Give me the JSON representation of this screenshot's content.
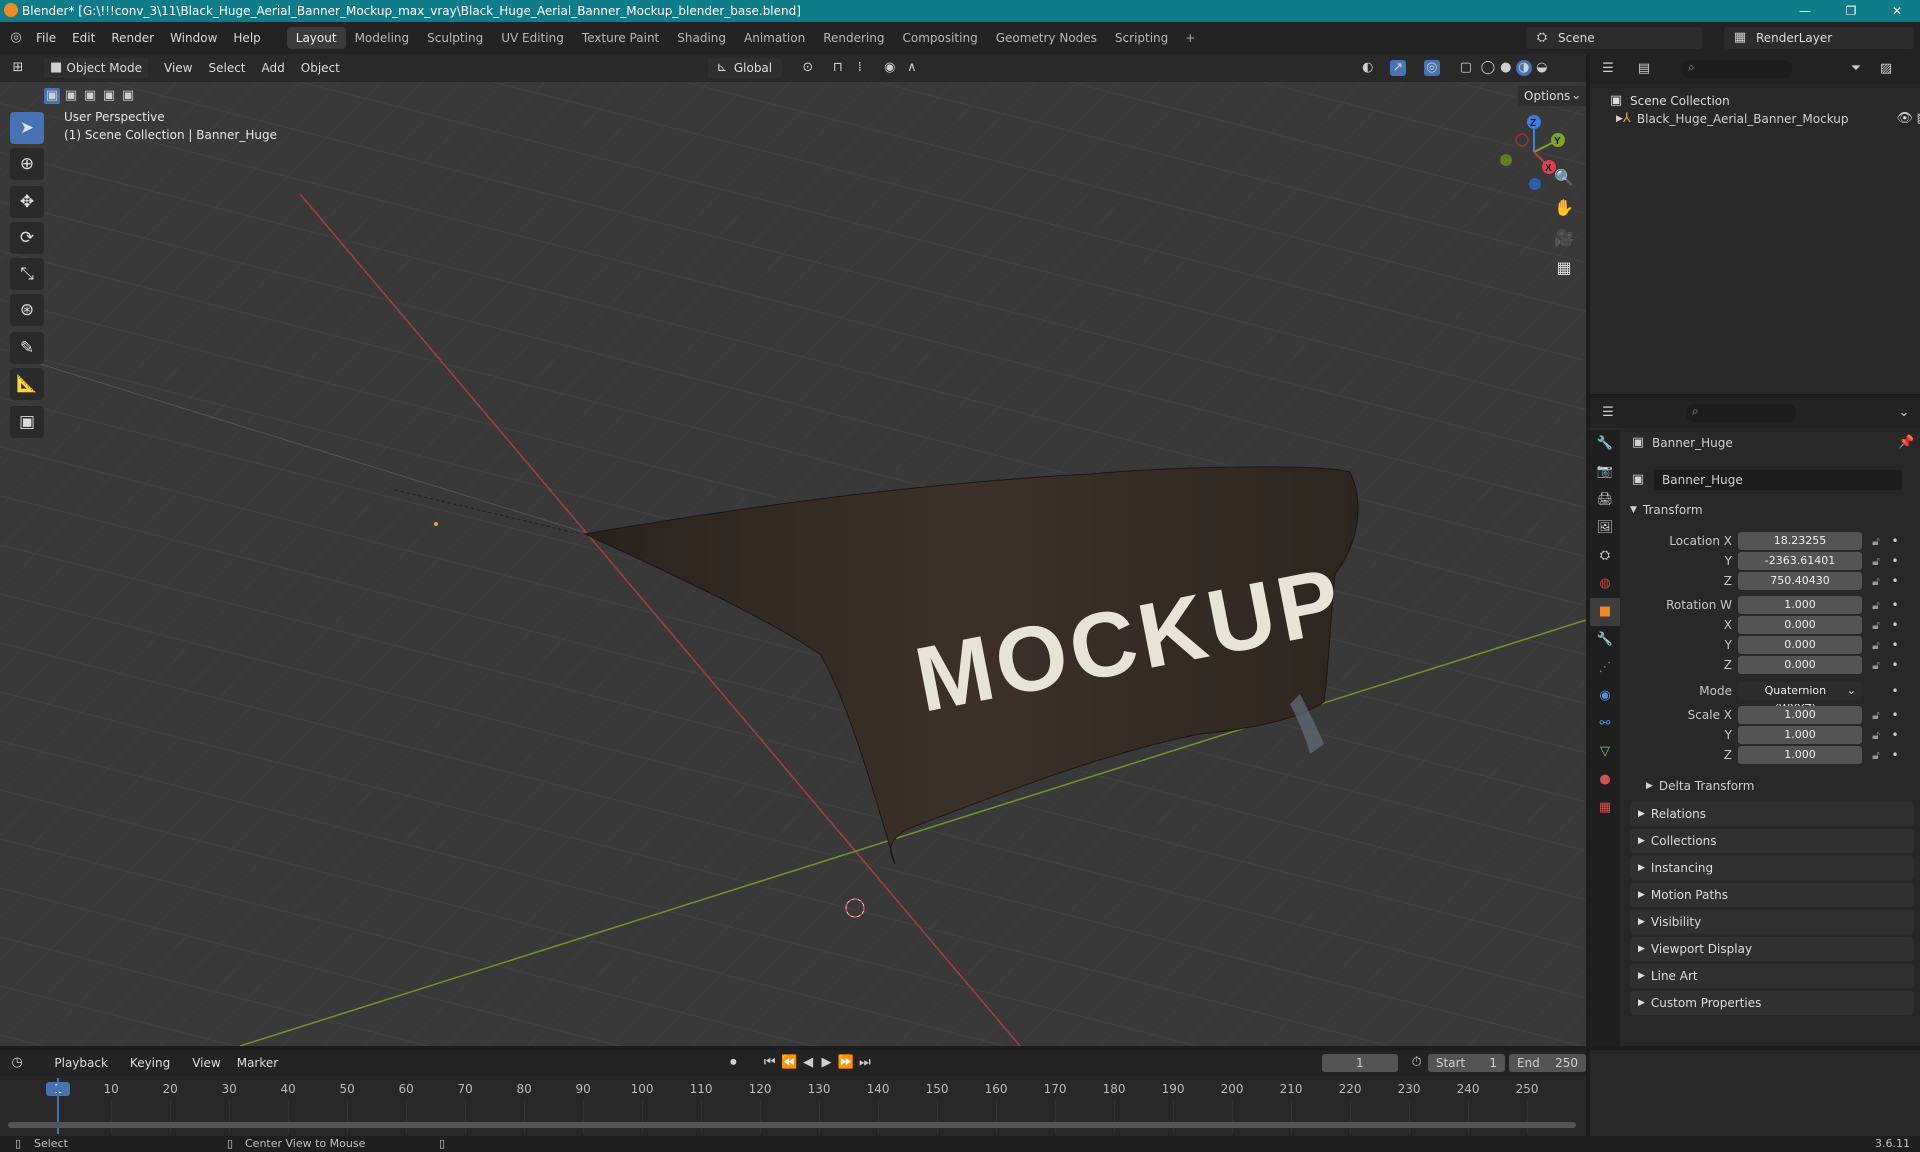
{
  "window": {
    "title": "Blender* [G:\\!!!conv_3\\11\\Black_Huge_Aerial_Banner_Mockup_max_vray\\Black_Huge_Aerial_Banner_Mockup_blender_base.blend]"
  },
  "menu": [
    "File",
    "Edit",
    "Render",
    "Window",
    "Help"
  ],
  "workspaces": [
    "Layout",
    "Modeling",
    "Sculpting",
    "UV Editing",
    "Texture Paint",
    "Shading",
    "Animation",
    "Rendering",
    "Compositing",
    "Geometry Nodes",
    "Scripting"
  ],
  "active_workspace": "Layout",
  "scene": {
    "name": "Scene",
    "render_layer": "RenderLayer"
  },
  "viewport": {
    "mode": "Object Mode",
    "menus": [
      "View",
      "Select",
      "Add",
      "Object"
    ],
    "orientation": "Global",
    "options_label": "Options",
    "perspective": "User Perspective",
    "collection_info": "(1) Scene Collection | Banner_Huge",
    "banner_text": "MOCKUP",
    "gizmo": {
      "x": "X",
      "y": "Y",
      "z": "Z"
    }
  },
  "outliner": {
    "root": "Scene Collection",
    "items": [
      {
        "name": "Black_Huge_Aerial_Banner_Mockup"
      }
    ]
  },
  "properties": {
    "object_name": "Banner_Huge",
    "data_name": "Banner_Huge",
    "transform_label": "Transform",
    "location": {
      "label_x": "Location X",
      "x": "18.23255",
      "y": "-2363.61401",
      "z": "750.40430"
    },
    "rotation": {
      "label_w": "Rotation W",
      "w": "1.000",
      "x": "0.000",
      "y": "0.000",
      "z": "0.000"
    },
    "mode": {
      "label": "Mode",
      "value": "Quaternion (WXYZ)"
    },
    "scale": {
      "label_x": "Scale X",
      "x": "1.000",
      "y": "1.000",
      "z": "1.000"
    },
    "axis_labels": {
      "y": "Y",
      "z": "Z",
      "x": "X"
    },
    "delta_transform": "Delta Transform",
    "panels": [
      "Relations",
      "Collections",
      "Instancing",
      "Motion Paths",
      "Visibility",
      "Viewport Display",
      "Line Art",
      "Custom Properties"
    ]
  },
  "timeline": {
    "menus": [
      "Playback",
      "Keying",
      "View",
      "Marker"
    ],
    "current_frame": "1",
    "start_label": "Start",
    "start": "1",
    "end_label": "End",
    "end": "250",
    "ticks": [
      "1",
      "10",
      "20",
      "30",
      "40",
      "50",
      "60",
      "70",
      "80",
      "90",
      "100",
      "110",
      "120",
      "130",
      "140",
      "150",
      "160",
      "170",
      "180",
      "190",
      "200",
      "210",
      "220",
      "230",
      "240",
      "250"
    ]
  },
  "status": {
    "select": "Select",
    "center_view": "Center View to Mouse",
    "version": "3.6.11"
  },
  "colors": {
    "accent": "#4772b3",
    "titlebar": "#0f7c8a",
    "x_axis": "#c83a3a",
    "y_axis": "#7da528",
    "frame_marker": "#4772b3"
  }
}
